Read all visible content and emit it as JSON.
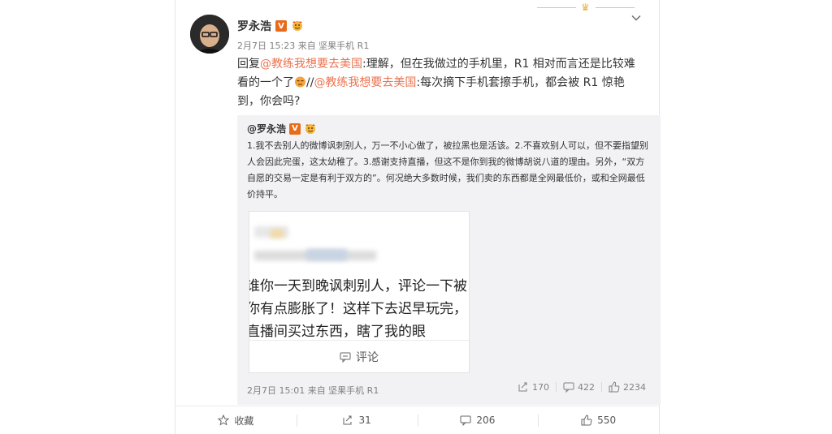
{
  "post": {
    "author": "罗永浩",
    "verified_badge": "V",
    "meta": "2月7日 15:23 来自 坚果手机 R1",
    "text": {
      "p1": "回复",
      "mention1": "@教练我想要去美国",
      "p2": ":理解，但在我做过的手机里，R1 相对而言还是比较难看的一个了",
      "p3": "//",
      "mention2": "@教练我想要去美国",
      "p4": ":每次摘下手机套擦手机，都会被 R1 惊艳到，你会吗?"
    }
  },
  "repost": {
    "author": "@罗永浩",
    "verified_badge": "V",
    "text": "1.我不去别人的微博讽刺别人，万一不小心做了，被拉黑也是活该。2.不喜欢别人可以，但不要指望别人会因此完蛋，这太幼稚了。3.感谢支持直播，但这不是你到我的微博胡说八道的理由。另外，“双方自愿的交易一定是有利于双方的”。何况绝大多数时候，我们卖的东西都是全网最低价，或和全网最低价持平。",
    "image": {
      "line1": "谁你一天到晚讽刺别人，评论一下被",
      "line2": "你有点膨胀了！这样下去迟早玩完，",
      "line3": "直播间买过东西，瞎了我的眼",
      "footer_label": "评论"
    },
    "meta": "2月7日 15:01 来自 坚果手机 R1",
    "stats": {
      "reposts": "170",
      "comments": "422",
      "likes": "2234"
    }
  },
  "actions": {
    "favorite": "收藏",
    "repost": "31",
    "comment": "206",
    "like": "550"
  },
  "colors": {
    "mention": "#eb7350",
    "badge": "#e86b1a",
    "meta": "#808080"
  }
}
